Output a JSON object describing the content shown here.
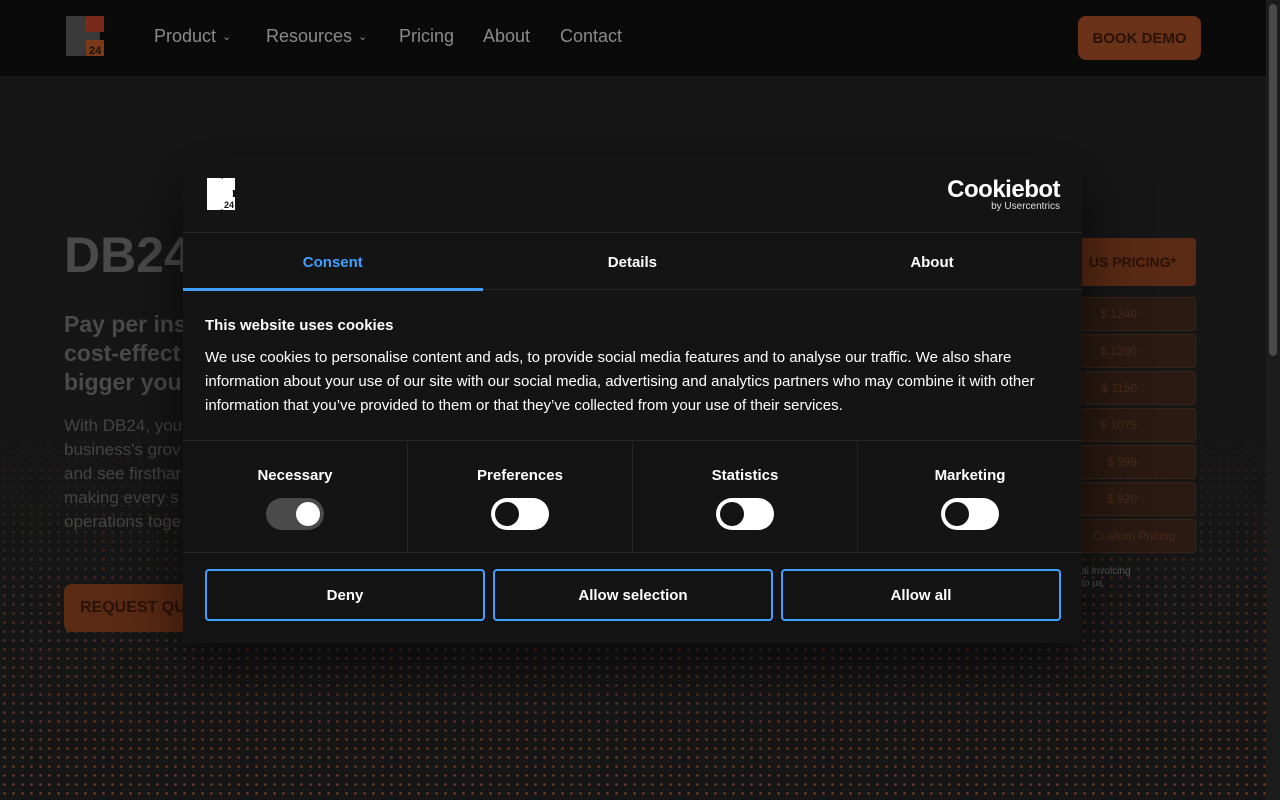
{
  "nav": {
    "items": [
      {
        "label": "Product",
        "has_dropdown": true
      },
      {
        "label": "Resources",
        "has_dropdown": true
      },
      {
        "label": "Pricing",
        "has_dropdown": false
      },
      {
        "label": "About",
        "has_dropdown": false
      },
      {
        "label": "Contact",
        "has_dropdown": false
      }
    ],
    "book_demo": "BOOK DEMO"
  },
  "hero": {
    "title": "DB24",
    "subtitle_lines": [
      "Pay per ins",
      "cost-effect",
      "bigger you"
    ],
    "body_lines": [
      "With DB24, you",
      "business's grov",
      "and see firsthar",
      "making every s",
      "operations toge"
    ],
    "request_button": "REQUEST QU"
  },
  "pricing": {
    "header": "US PRICING*",
    "rows": [
      "$ 1240",
      "$ 1200",
      "$ 1150",
      "$ 1075",
      "$ 999",
      "$ 920",
      "Custom Pricing"
    ],
    "note_lines": [
      "nual invoicing",
      "ut to us"
    ]
  },
  "dialog": {
    "logo_text": "24",
    "brand": "Cookiebot",
    "brand_by": "by Usercentrics",
    "tabs": [
      {
        "label": "Consent",
        "active": true
      },
      {
        "label": "Details",
        "active": false
      },
      {
        "label": "About",
        "active": false
      }
    ],
    "title": "This website uses cookies",
    "text": "We use cookies to personalise content and ads, to provide social media features and to analyse our traffic. We also share information about your use of our site with our social media, advertising and analytics partners who may combine it with other information that you’ve provided to them or that they’ve collected from your use of their services.",
    "toggles": [
      {
        "label": "Necessary",
        "checked": true
      },
      {
        "label": "Preferences",
        "checked": false
      },
      {
        "label": "Statistics",
        "checked": false
      },
      {
        "label": "Marketing",
        "checked": false
      }
    ],
    "buttons": {
      "deny": "Deny",
      "allow_selection": "Allow selection",
      "allow_all": "Allow all"
    }
  },
  "colors": {
    "accent": "#3fa0ff",
    "brand_orange": "#e06a30",
    "dialog_bg": "#141414"
  }
}
